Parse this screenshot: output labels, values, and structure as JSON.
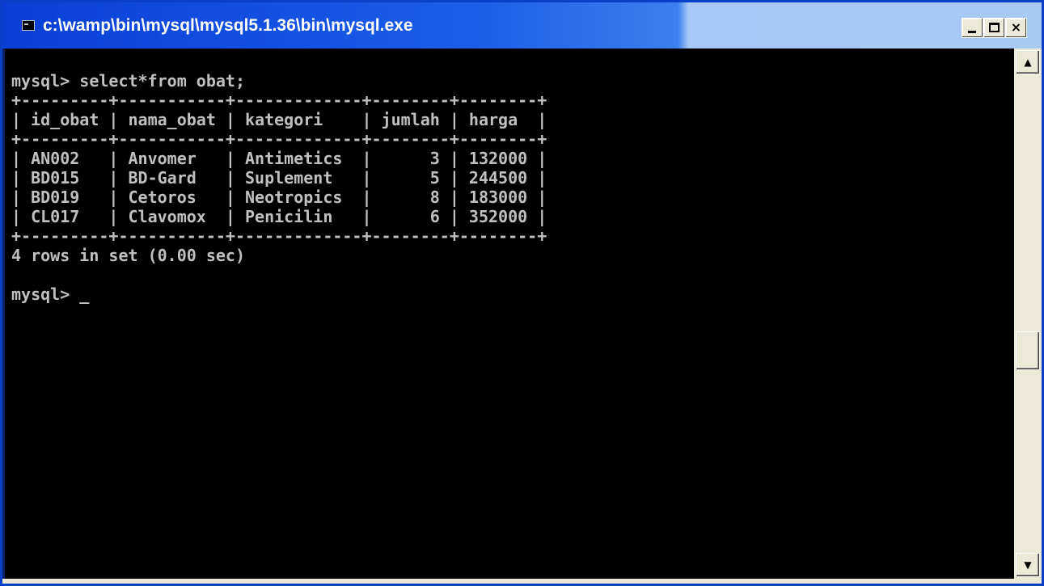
{
  "window": {
    "title": "c:\\wamp\\bin\\mysql\\mysql5.1.36\\bin\\mysql.exe",
    "controls": {
      "minimize": "",
      "maximize": "",
      "close": "×"
    }
  },
  "console": {
    "lines": [
      "mysql> select*from obat;",
      "+---------+-----------+-------------+--------+--------+",
      "| id_obat | nama_obat | kategori    | jumlah | harga  |",
      "+---------+-----------+-------------+--------+--------+",
      "| AN002   | Anvomer   | Antimetics  |      3 | 132000 |",
      "| BD015   | BD-Gard   | Suplement   |      5 | 244500 |",
      "| BD019   | Cetoros   | Neotropics  |      8 | 183000 |",
      "| CL017   | Clavomox  | Penicilin   |      6 | 352000 |",
      "+---------+-----------+-------------+--------+--------+",
      "4 rows in set (0.00 sec)",
      "",
      "mysql> "
    ],
    "cursor": "_",
    "table": {
      "columns": [
        "id_obat",
        "nama_obat",
        "kategori",
        "jumlah",
        "harga"
      ],
      "rows": [
        [
          "AN002",
          "Anvomer",
          "Antimetics",
          "3",
          "132000"
        ],
        [
          "BD015",
          "BD-Gard",
          "Suplement",
          "5",
          "244500"
        ],
        [
          "BD019",
          "Cetoros",
          "Neotropics",
          "8",
          "183000"
        ],
        [
          "CL017",
          "Clavomox",
          "Penicilin",
          "6",
          "352000"
        ]
      ]
    }
  },
  "scrollbar": {
    "up_icon": "▲",
    "down_icon": "▼"
  },
  "colors": {
    "console_bg": "#000000",
    "console_fg": "#c0c0c0",
    "titlebar_start": "#0a3fd6",
    "chrome": "#ece9d8"
  }
}
